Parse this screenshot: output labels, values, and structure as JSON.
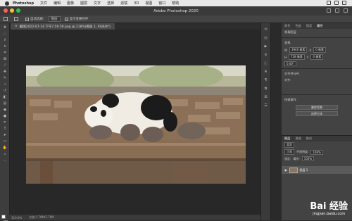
{
  "menubar": {
    "app": "Photoshop",
    "items": [
      "文件",
      "编辑",
      "图像",
      "图层",
      "文字",
      "选择",
      "滤镜",
      "3D",
      "视图",
      "窗口",
      "帮助"
    ]
  },
  "titlebar": {
    "title": "Adobe Photoshop 2020"
  },
  "options": {
    "auto_select": "自动选择：",
    "auto_value": "图层",
    "transform": "显示变换控件"
  },
  "doc": {
    "tab": "截图2022-07-14 下午7.59.59.png @ 118%(图层 1, RGB/8*)",
    "close": "×"
  },
  "status": {
    "zoom": "119.6%",
    "doc": "文档:2.78M/2.78M"
  },
  "panel": {
    "tabs": [
      "颜色",
      "色板",
      "图案",
      "属性"
    ],
    "active_tab": "属性",
    "pixel_layer": "像素图层",
    "transform_label": "变换",
    "w_label": "W",
    "w_value": "1940 像素",
    "h_label": "H",
    "h_value": "728 像素",
    "x_label": "X",
    "x_value": "0 像素",
    "y_label": "Y",
    "y_value": "0 像素",
    "angle": "0.00°",
    "align_label": "对齐并分布",
    "align_sub": "对齐:",
    "quick_label": "快速操作",
    "btn1": "删除背景",
    "btn2": "选择主体"
  },
  "layers": {
    "tabs": [
      "图层",
      "通道",
      "路径"
    ],
    "active_tab": "图层",
    "kind": "类型",
    "mode": "正常",
    "opacity_label": "不透明度:",
    "opacity": "100%",
    "lock_label": "锁定:",
    "fill_label": "填充:",
    "fill": "100%",
    "layer_name": "图层 1"
  },
  "watermark": {
    "brand": "Bai 经验",
    "url": "jingyan.baidu.com"
  },
  "colors": {
    "accent": "#2d6fd6",
    "dark": "#2a2a2a"
  }
}
